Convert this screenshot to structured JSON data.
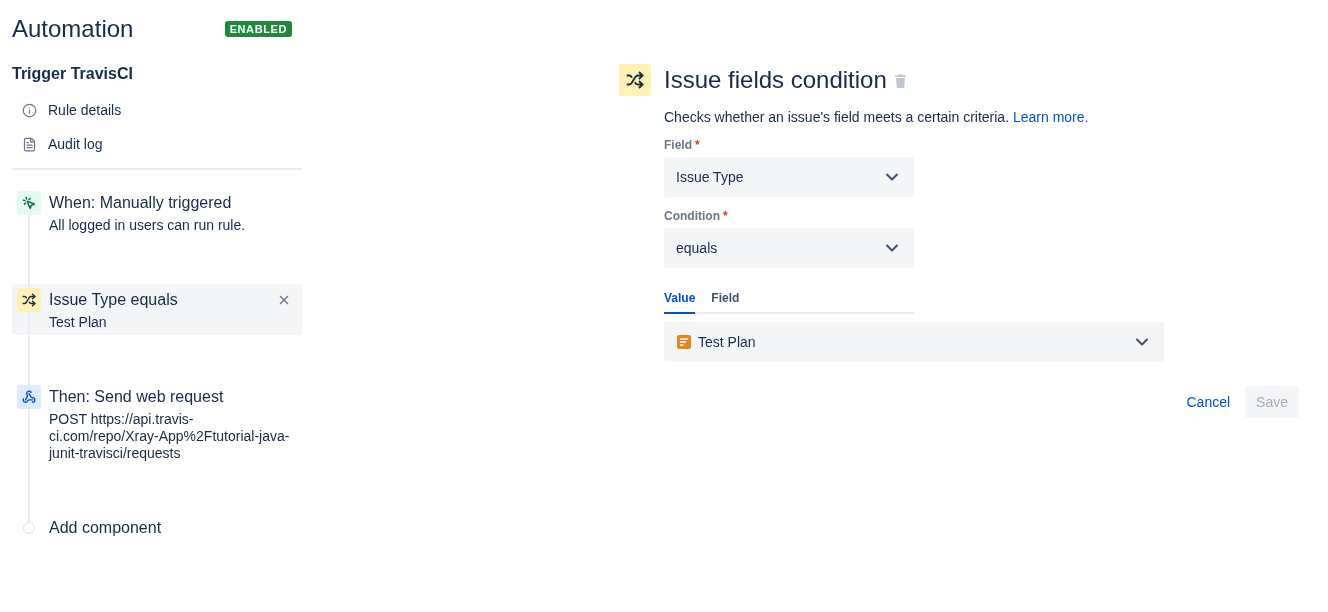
{
  "sidebar": {
    "title": "Automation",
    "status_badge": "ENABLED",
    "rule_name": "Trigger TravisCI",
    "links": [
      {
        "kind": "details",
        "label": "Rule details"
      },
      {
        "kind": "audit",
        "label": "Audit log"
      }
    ]
  },
  "components": [
    {
      "kind": "trigger",
      "title": "When: Manually triggered",
      "description": "All logged in users can run rule.",
      "selected": false
    },
    {
      "kind": "condition",
      "title": "Issue Type equals",
      "description": "Test Plan",
      "selected": true
    },
    {
      "kind": "action",
      "title": "Then: Send web request",
      "description": "POST https://api.travis-ci.com/repo/Xray-App%2Ftutorial-java-junit-travisci/requests",
      "selected": false
    },
    {
      "kind": "add",
      "title": "Add component",
      "selected": false
    }
  ],
  "editor": {
    "kind": "condition",
    "title": "Issue fields condition",
    "description": "Checks whether an issue's field meets a certain criteria.",
    "link": "Learn more.",
    "fields": [
      {
        "label": "Field",
        "required_mark": "*",
        "value": "Issue Type"
      },
      {
        "label": "Condition",
        "required_mark": "*",
        "value": "equals"
      }
    ],
    "value_tabs": [
      {
        "label": "Value",
        "selected": true
      },
      {
        "label": "Field",
        "selected": false
      }
    ],
    "value_select": {
      "value": "Test Plan"
    },
    "buttons": [
      {
        "kind": "link",
        "label": "Cancel",
        "disabled": false
      },
      {
        "kind": "primary",
        "label": "Save",
        "disabled": true
      }
    ]
  }
}
